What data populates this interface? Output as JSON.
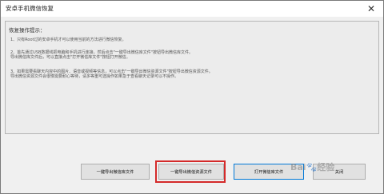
{
  "window": {
    "title": "安卓手机微信恢复",
    "close_glyph": "✕"
  },
  "panel": {
    "heading": "恢复操作提示：",
    "lines": [
      "1、只有Root过的安卓手机才可以使用当前的方法进行微信恢复。",
      "2、首先通过USB数据线把电脑和手机进行连接，然后点击\"一键导出微信库文件\"按钮导出微信库文件。\n导出微信库文件后，可以直接点击\"打开微信库文件\"按钮打开微信。",
      "3、如果需要看聊天内容中的图片、语音或视频等信息，可以点击\"一键导出微信资源文件\"按钮导出微信资源文件。\n导出微信资源文件会很慢需要耐心等待，请多等重可选操作如果急于查看聊天记录可以不操作。"
    ]
  },
  "buttons": {
    "export_db": "一键导出微信库文件",
    "export_resources": "一键导出微信资源文件",
    "open_db": "打开微信库文件",
    "close": "关闭"
  },
  "watermark": "Bai🐾经验",
  "colors": {
    "highlight": "#d42a2a",
    "focus_border": "#0078d7"
  }
}
